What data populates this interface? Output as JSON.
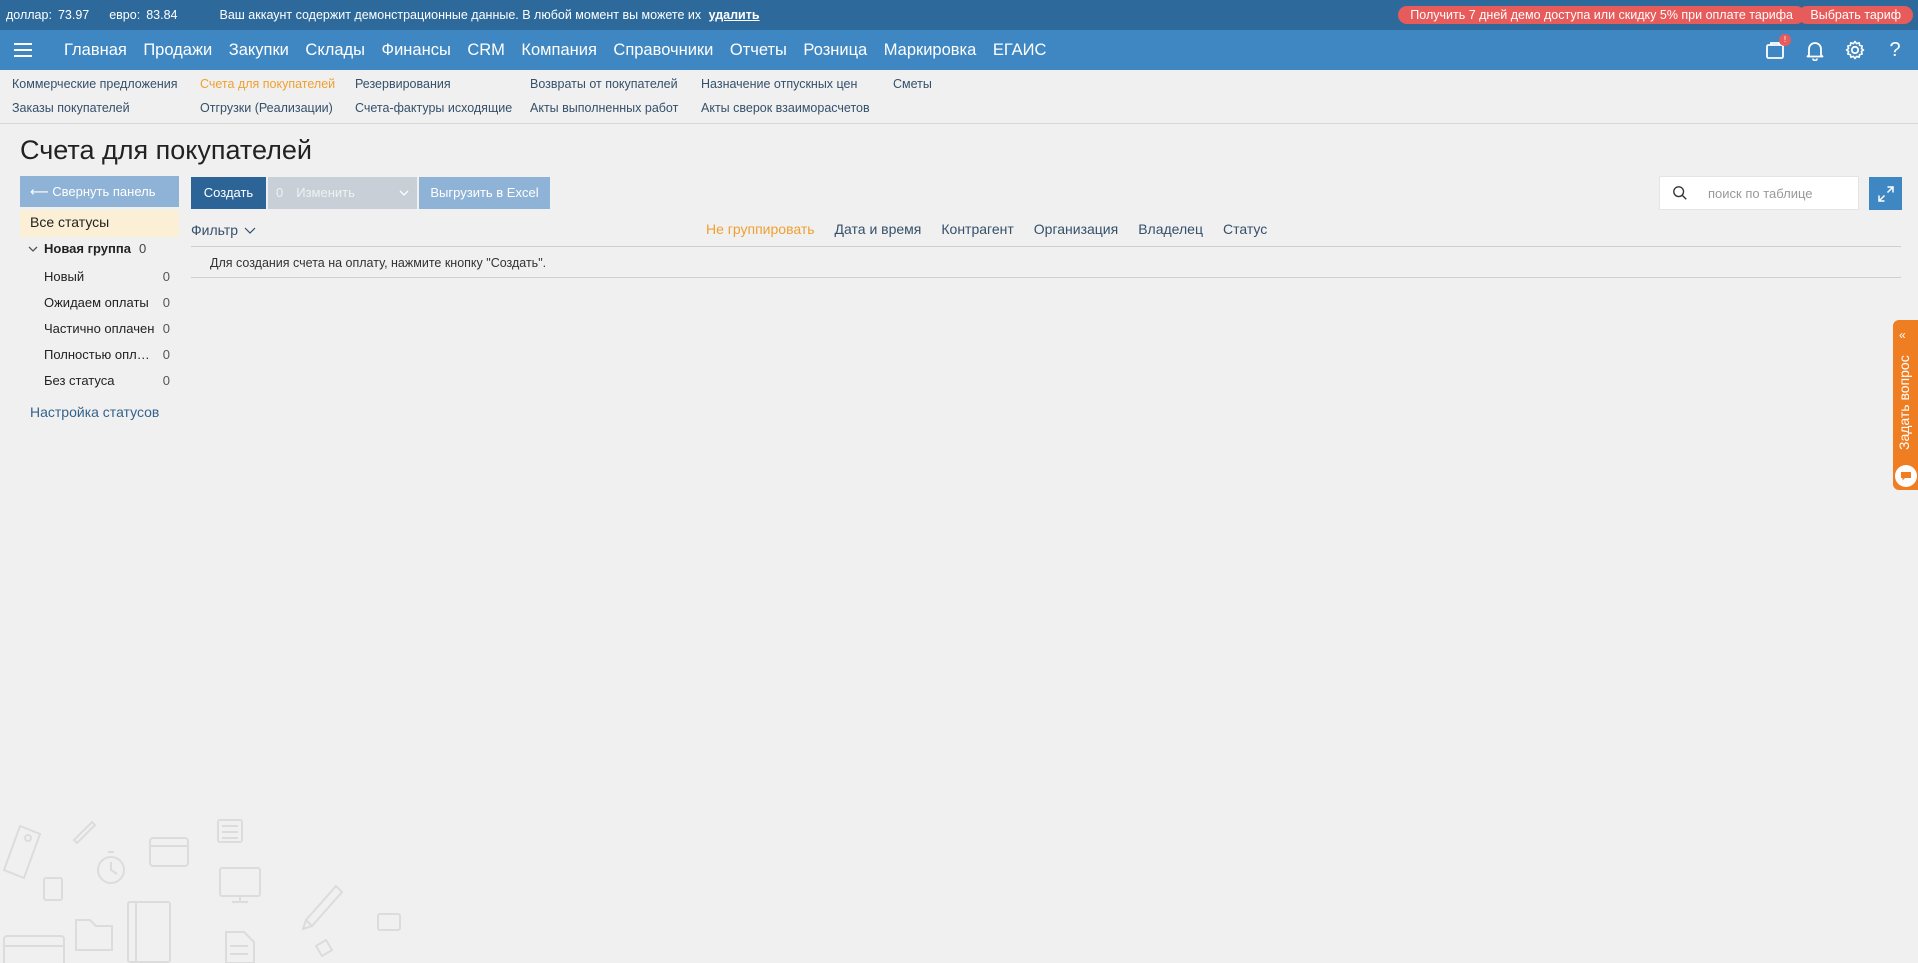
{
  "infobar": {
    "dollar_label": "доллар:",
    "dollar_value": "73.97",
    "euro_label": "евро:",
    "euro_value": "83.84",
    "demo_message": "Ваш аккаунт содержит демонстрационные данные. В любой момент вы можете их",
    "delete_link": "удалить",
    "promo_button": "Получить 7 дней демо доступа или скидку 5% при оплате тарифа",
    "tariff_button": "Выбрать тариф"
  },
  "mainnav": {
    "items": [
      "Главная",
      "Продажи",
      "Закупки",
      "Склады",
      "Финансы",
      "CRM",
      "Компания",
      "Справочники",
      "Отчеты",
      "Розница",
      "Маркировка",
      "ЕГАИС"
    ],
    "active_index": 1,
    "cart_badge": "!",
    "help": "?"
  },
  "subnav": {
    "items": [
      "Коммерческие предложения",
      "Заказы покупателей",
      "Счета для покупателей",
      "Отгрузки (Реализации)",
      "Резервирования",
      "Счета-фактуры исходящие",
      "Возвраты от покупателей",
      "Акты выполненных работ",
      "Назначение отпускных цен",
      "Акты сверок взаиморасчетов",
      "Сметы"
    ],
    "active_index": 2
  },
  "page": {
    "title": "Счета для покупателей"
  },
  "sidebar": {
    "collapse_label": "⟵ Свернуть панель",
    "all_statuses": "Все статусы",
    "group_name": "Новая группа",
    "group_count": "0",
    "statuses": [
      {
        "label": "Новый",
        "count": "0"
      },
      {
        "label": "Ожидаем оплаты",
        "count": "0"
      },
      {
        "label": "Частично оплачен",
        "count": "0"
      },
      {
        "label": "Полностью оплачен",
        "count": "0"
      },
      {
        "label": "Без статуса",
        "count": "0"
      }
    ],
    "settings_link": "Настройка статусов"
  },
  "toolbar": {
    "create_label": "Создать",
    "change_count": "0",
    "change_label": "Изменить",
    "excel_label": "Выгрузить в Excel",
    "search_placeholder": "поиск по таблице"
  },
  "table": {
    "filter_label": "Фильтр",
    "groupings": [
      "Не группировать",
      "Дата и время",
      "Контрагент",
      "Организация",
      "Владелец",
      "Статус"
    ],
    "active_grouping": 0,
    "empty_message": "Для создания счета на оплату, нажмите кнопку \"Создать\"."
  },
  "support": {
    "ask_label": "Задать вопрос"
  },
  "colors": {
    "infobar_bg": "#2d6a9b",
    "nav_bg": "#3f87c2",
    "accent_active": "#f0a030",
    "primary_button": "#2c6498",
    "promo": "#e85b5b",
    "ask_tab": "#ef7d22"
  }
}
